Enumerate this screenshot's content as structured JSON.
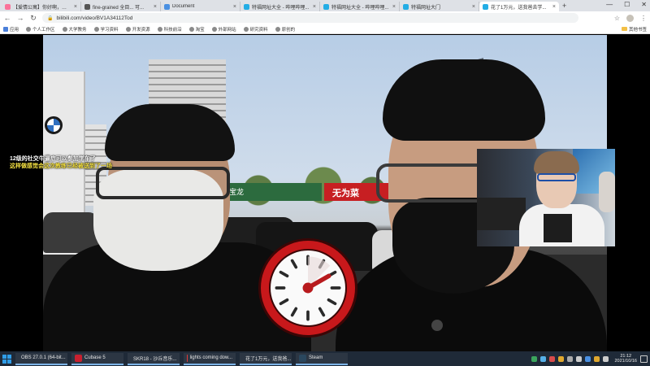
{
  "browser": {
    "tabs": [
      {
        "title": "【爱情公寓】你好啊，我是...",
        "color": "#fb7299"
      },
      {
        "title": "fine-grained 全目... 可...",
        "color": "#555555"
      },
      {
        "title": "Document",
        "color": "#4a90e2"
      },
      {
        "title": "特福网址大全 - 哔哩哔哩...",
        "color": "#23ade5"
      },
      {
        "title": "特福网址大全 - 哔哩哔哩...",
        "color": "#23ade5"
      },
      {
        "title": "特福网址大门",
        "color": "#23ade5"
      },
      {
        "title": "花了1万元，送我爸去学...",
        "color": "#23ade5",
        "active": true
      }
    ],
    "new_tab": "+",
    "window_controls": {
      "minimize": "—",
      "maximize": "☐",
      "close": "✕"
    },
    "nav": {
      "back": "←",
      "forward": "→",
      "reload": "↻"
    },
    "url": "bilibili.com/video/BV1A34112Tod",
    "toolbar_icons": {
      "star": "☆",
      "extensions": "⋮"
    },
    "bookmarks": [
      {
        "label": "应用",
        "apps": true
      },
      {
        "label": "个人工作区"
      },
      {
        "label": "大学教务"
      },
      {
        "label": "学习资料"
      },
      {
        "label": "开发资源"
      },
      {
        "label": "科技前沿"
      },
      {
        "label": "淘宝"
      },
      {
        "label": "外部网站"
      },
      {
        "label": "研究资料"
      },
      {
        "label": "原创的"
      }
    ],
    "other_bookmarks": "其他书签"
  },
  "video": {
    "danmaku": [
      "12级的社交牛逼症可以参加学车了",
      "这样做感觉会这次教练已经被送到了一场"
    ],
    "signs": {
      "green": "宝龙  ",
      "red": "无为菜"
    },
    "clock_icon": "stopwatch-icon"
  },
  "taskbar": {
    "items": [
      {
        "label": "OBS 27.0.1 (64-bit...",
        "color": "#302e31"
      },
      {
        "label": "Cubase 5",
        "color": "#c8202f"
      },
      {
        "label": "SKR18 - 沙丘音乐...",
        "color": "#f5c518"
      },
      {
        "label": "lights coming dow...",
        "color": "#e03a3a"
      },
      {
        "label": "花了1万元，送我爸...",
        "color": "#4285f4"
      },
      {
        "label": "Steam",
        "color": "#2a475e"
      }
    ],
    "tray_icons": [
      "#3ba55d",
      "#56b0e8",
      "#d84b4b",
      "#e0a82e",
      "#aaaaaa",
      "#cccccc",
      "#4a90e2",
      "#e0a82e",
      "#cccccc"
    ],
    "time": "21:12",
    "date": "2021/10/16"
  }
}
